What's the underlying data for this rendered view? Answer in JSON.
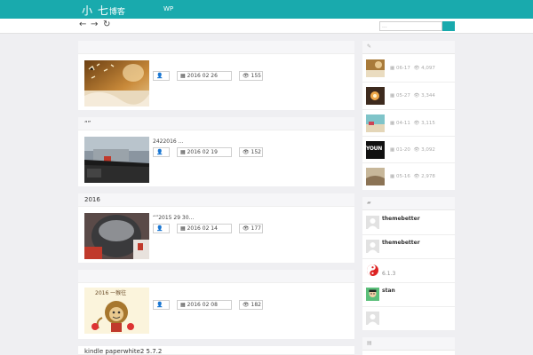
{
  "site": {
    "logo_big": "小 七",
    "logo_small": "博客",
    "nav_link": "WP"
  },
  "toolbar": {
    "back_icon": "←",
    "forward_icon": "→",
    "refresh_icon": "↻",
    "search_placeholder": "..."
  },
  "posts": [
    {
      "title": "",
      "excerpt": "",
      "author_icon": "👤",
      "date": "▦ 2016  02  26",
      "views": "👁 155"
    },
    {
      "title": "“”",
      "excerpt": "2422016 ...",
      "author_icon": "👤",
      "date": "▦ 2016  02  19",
      "views": "👁 152"
    },
    {
      "title": "2016",
      "excerpt": "“”2015 29 30...",
      "author_icon": "👤",
      "date": "▦ 2016  02  14",
      "views": "👁 177"
    },
    {
      "title": "",
      "excerpt": "",
      "author_icon": "👤",
      "date": "▦ 2016  02  08",
      "views": "👁 182",
      "thumb_caption": "2016 一猴往"
    },
    {
      "title": "kindle paperwhite2 5.7.2"
    }
  ],
  "sidebar": {
    "hot_icon": "✎",
    "hot": [
      {
        "date": "▦ 06-17",
        "views": "👁 4,097"
      },
      {
        "date": "▦ 05-27",
        "views": "👁 3,344"
      },
      {
        "date": "▦ 04-11",
        "views": "👁 3,115"
      },
      {
        "date": "▦ 01-20",
        "views": "👁 3,092",
        "thumb_text": "YOUN"
      },
      {
        "date": "▦ 05-16",
        "views": "👁 2,978"
      }
    ],
    "comments_icon": "▰",
    "comments": [
      {
        "name": "themebetter",
        "text": ""
      },
      {
        "name": "themebetter",
        "text": ""
      },
      {
        "name": "",
        "text": "6.1.3"
      },
      {
        "name": "stan",
        "text": ""
      },
      {
        "name": "",
        "text": ""
      }
    ],
    "third_icon": "▤"
  },
  "colors": {
    "accent": "#19aaad",
    "page_bg": "#efeff2"
  }
}
